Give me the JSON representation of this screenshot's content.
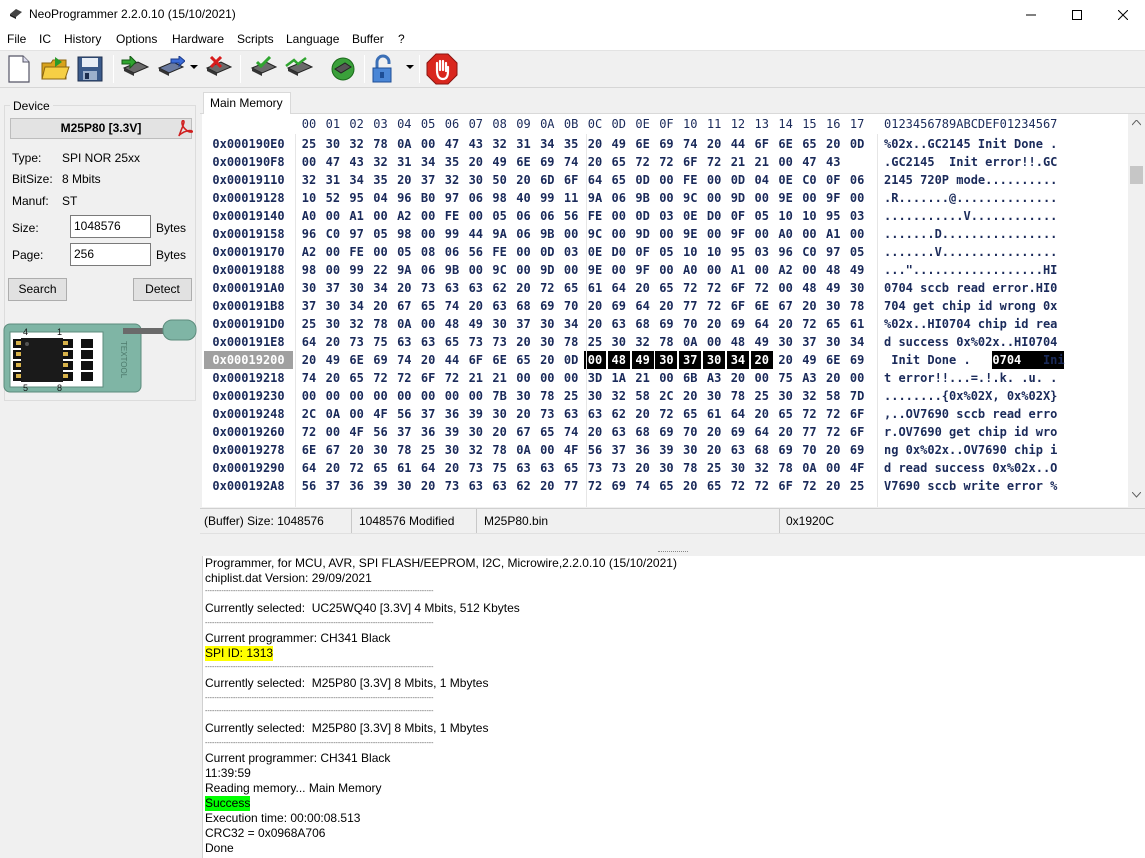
{
  "window": {
    "title": "NeoProgrammer 2.2.0.10 (15/10/2021)"
  },
  "menu": [
    "File",
    "IC",
    "History",
    "Options",
    "Hardware",
    "Scripts",
    "Language",
    "Buffer",
    "?"
  ],
  "toolbar": {
    "icons": [
      "new-file-icon",
      "open-folder-icon",
      "save-disk-icon",
      "read-chip-icon",
      "write-chip-icon",
      "erase-chip-icon",
      "verify-chip-icon",
      "blank-check-icon",
      "auto-program-icon",
      "protect-lock-icon",
      "stop-icon"
    ]
  },
  "device": {
    "group_label": "Device",
    "name": "M25P80 [3.3V]",
    "type_label": "Type:",
    "type_value": "SPI NOR 25xx",
    "bitsize_label": "BitSize:",
    "bitsize_value": "8 Mbits",
    "manuf_label": "Manuf:",
    "manuf_value": "ST",
    "size_label": "Size:",
    "size_value": "1048576",
    "size_unit": "Bytes",
    "page_label": "Page:",
    "page_value": "256",
    "page_unit": "Bytes",
    "search_button": "Search",
    "detect_button": "Detect",
    "socket_pin_labels": [
      "4",
      "1",
      "5",
      "8"
    ],
    "socket_brand": "TEXTOOL"
  },
  "hex": {
    "tab_label": "Main Memory",
    "header_bytes": [
      "00",
      "01",
      "02",
      "03",
      "04",
      "05",
      "06",
      "07",
      "08",
      "09",
      "0A",
      "0B",
      "0C",
      "0D",
      "0E",
      "0F",
      "10",
      "11",
      "12",
      "13",
      "14",
      "15",
      "16",
      "17"
    ],
    "header_ascii": "0123456789ABCDEF01234567",
    "rows": [
      {
        "addr": "0x000190E0",
        "bytes": [
          "25",
          "30",
          "32",
          "78",
          "0A",
          "00",
          "47",
          "43",
          "32",
          "31",
          "34",
          "35",
          "20",
          "49",
          "6E",
          "69",
          "74",
          "20",
          "44",
          "6F",
          "6E",
          "65",
          "20",
          "0D"
        ],
        "ascii": "%02x..GC2145 Init Done ."
      },
      {
        "addr": "0x000190F8",
        "bytes": [
          "00",
          "47",
          "43",
          "32",
          "31",
          "34",
          "35",
          "20",
          "49",
          "6E",
          "69",
          "74",
          "20",
          "65",
          "72",
          "72",
          "6F",
          "72",
          "21",
          "21",
          "00",
          "47",
          "43"
        ],
        "ascii": ".GC2145  Init error!!.GC"
      },
      {
        "addr": "0x00019110",
        "bytes": [
          "32",
          "31",
          "34",
          "35",
          "20",
          "37",
          "32",
          "30",
          "50",
          "20",
          "6D",
          "6F",
          "64",
          "65",
          "0D",
          "00",
          "FE",
          "00",
          "0D",
          "04",
          "0E",
          "C0",
          "0F",
          "06"
        ],
        "ascii": "2145 720P mode.........."
      },
      {
        "addr": "0x00019128",
        "bytes": [
          "10",
          "52",
          "95",
          "04",
          "96",
          "B0",
          "97",
          "06",
          "98",
          "40",
          "99",
          "11",
          "9A",
          "06",
          "9B",
          "00",
          "9C",
          "00",
          "9D",
          "00",
          "9E",
          "00",
          "9F",
          "00"
        ],
        "ascii": ".R.......@.............."
      },
      {
        "addr": "0x00019140",
        "bytes": [
          "A0",
          "00",
          "A1",
          "00",
          "A2",
          "00",
          "FE",
          "00",
          "05",
          "06",
          "06",
          "56",
          "FE",
          "00",
          "0D",
          "03",
          "0E",
          "D0",
          "0F",
          "05",
          "10",
          "10",
          "95",
          "03"
        ],
        "ascii": "...........V............"
      },
      {
        "addr": "0x00019158",
        "bytes": [
          "96",
          "C0",
          "97",
          "05",
          "98",
          "00",
          "99",
          "44",
          "9A",
          "06",
          "9B",
          "00",
          "9C",
          "00",
          "9D",
          "00",
          "9E",
          "00",
          "9F",
          "00",
          "A0",
          "00",
          "A1",
          "00"
        ],
        "ascii": ".......D................"
      },
      {
        "addr": "0x00019170",
        "bytes": [
          "A2",
          "00",
          "FE",
          "00",
          "05",
          "08",
          "06",
          "56",
          "FE",
          "00",
          "0D",
          "03",
          "0E",
          "D0",
          "0F",
          "05",
          "10",
          "10",
          "95",
          "03",
          "96",
          "C0",
          "97",
          "05"
        ],
        "ascii": ".......V................"
      },
      {
        "addr": "0x00019188",
        "bytes": [
          "98",
          "00",
          "99",
          "22",
          "9A",
          "06",
          "9B",
          "00",
          "9C",
          "00",
          "9D",
          "00",
          "9E",
          "00",
          "9F",
          "00",
          "A0",
          "00",
          "A1",
          "00",
          "A2",
          "00",
          "48",
          "49"
        ],
        "ascii": "...\"..................HI"
      },
      {
        "addr": "0x000191A0",
        "bytes": [
          "30",
          "37",
          "30",
          "34",
          "20",
          "73",
          "63",
          "63",
          "62",
          "20",
          "72",
          "65",
          "61",
          "64",
          "20",
          "65",
          "72",
          "72",
          "6F",
          "72",
          "00",
          "48",
          "49",
          "30"
        ],
        "ascii": "0704 sccb read error.HI0"
      },
      {
        "addr": "0x000191B8",
        "bytes": [
          "37",
          "30",
          "34",
          "20",
          "67",
          "65",
          "74",
          "20",
          "63",
          "68",
          "69",
          "70",
          "20",
          "69",
          "64",
          "20",
          "77",
          "72",
          "6F",
          "6E",
          "67",
          "20",
          "30",
          "78"
        ],
        "ascii": "704 get chip id wrong 0x"
      },
      {
        "addr": "0x000191D0",
        "bytes": [
          "25",
          "30",
          "32",
          "78",
          "0A",
          "00",
          "48",
          "49",
          "30",
          "37",
          "30",
          "34",
          "20",
          "63",
          "68",
          "69",
          "70",
          "20",
          "69",
          "64",
          "20",
          "72",
          "65",
          "61"
        ],
        "ascii": "%02x..HI0704 chip id rea"
      },
      {
        "addr": "0x000191E8",
        "bytes": [
          "64",
          "20",
          "73",
          "75",
          "63",
          "63",
          "65",
          "73",
          "73",
          "20",
          "30",
          "78",
          "25",
          "30",
          "32",
          "78",
          "0A",
          "00",
          "48",
          "49",
          "30",
          "37",
          "30",
          "34"
        ],
        "ascii": "d success 0x%02x..HI0704"
      },
      {
        "addr": "0x00019200",
        "bytes": [
          "20",
          "49",
          "6E",
          "69",
          "74",
          "20",
          "44",
          "6F",
          "6E",
          "65",
          "20",
          "0D",
          "00",
          "48",
          "49",
          "30",
          "37",
          "30",
          "34",
          "20",
          "20",
          "49",
          "6E",
          "69"
        ],
        "ascii": " Init Done . HI0704   Ini"
      },
      {
        "addr": "0x00019218",
        "bytes": [
          "74",
          "20",
          "65",
          "72",
          "72",
          "6F",
          "72",
          "21",
          "21",
          "00",
          "00",
          "00",
          "3D",
          "1A",
          "21",
          "00",
          "6B",
          "A3",
          "20",
          "00",
          "75",
          "A3",
          "20",
          "00"
        ],
        "ascii": "t error!!...=.!.k. .u. ."
      },
      {
        "addr": "0x00019230",
        "bytes": [
          "00",
          "00",
          "00",
          "00",
          "00",
          "00",
          "00",
          "00",
          "7B",
          "30",
          "78",
          "25",
          "30",
          "32",
          "58",
          "2C",
          "20",
          "30",
          "78",
          "25",
          "30",
          "32",
          "58",
          "7D"
        ],
        "ascii": "........{0x%02X, 0x%02X}"
      },
      {
        "addr": "0x00019248",
        "bytes": [
          "2C",
          "0A",
          "00",
          "4F",
          "56",
          "37",
          "36",
          "39",
          "30",
          "20",
          "73",
          "63",
          "63",
          "62",
          "20",
          "72",
          "65",
          "61",
          "64",
          "20",
          "65",
          "72",
          "72",
          "6F"
        ],
        "ascii": ",..OV7690 sccb read erro"
      },
      {
        "addr": "0x00019260",
        "bytes": [
          "72",
          "00",
          "4F",
          "56",
          "37",
          "36",
          "39",
          "30",
          "20",
          "67",
          "65",
          "74",
          "20",
          "63",
          "68",
          "69",
          "70",
          "20",
          "69",
          "64",
          "20",
          "77",
          "72",
          "6F"
        ],
        "ascii": "r.OV7690 get chip id wro"
      },
      {
        "addr": "0x00019278",
        "bytes": [
          "6E",
          "67",
          "20",
          "30",
          "78",
          "25",
          "30",
          "32",
          "78",
          "0A",
          "00",
          "4F",
          "56",
          "37",
          "36",
          "39",
          "30",
          "20",
          "63",
          "68",
          "69",
          "70",
          "20",
          "69"
        ],
        "ascii": "ng 0x%02x..OV7690 chip i"
      },
      {
        "addr": "0x00019290",
        "bytes": [
          "64",
          "20",
          "72",
          "65",
          "61",
          "64",
          "20",
          "73",
          "75",
          "63",
          "63",
          "65",
          "73",
          "73",
          "20",
          "30",
          "78",
          "25",
          "30",
          "32",
          "78",
          "0A",
          "00",
          "4F"
        ],
        "ascii": "d read success 0x%02x..O"
      },
      {
        "addr": "0x000192A8",
        "bytes": [
          "56",
          "37",
          "36",
          "39",
          "30",
          "20",
          "73",
          "63",
          "63",
          "62",
          "20",
          "77",
          "72",
          "69",
          "74",
          "65",
          "20",
          "65",
          "72",
          "72",
          "6F",
          "72",
          "20",
          "25"
        ],
        "ascii": "V7690 sccb write error %"
      }
    ]
  },
  "status": {
    "buffer_size": "(Buffer) Size: 1048576",
    "modified": "1048576 Modified",
    "file": "M25P80.bin",
    "offset": "0x1920C"
  },
  "log": {
    "lines": [
      {
        "text": "Programmer, for MCU, AVR, SPI FLASH/EEPROM, I2C, Microwire,2.2.0.10 (15/10/2021)",
        "hl": ""
      },
      {
        "text": "chiplist.dat Version: 29/09/2021",
        "hl": ""
      },
      {
        "text": "--------------------------------------------------------------------------------------------------",
        "hl": ""
      },
      {
        "text": "Currently selected:  UC25WQ40 [3.3V] 4 Mbits, 512 Kbytes",
        "hl": ""
      },
      {
        "text": "--------------------------------------------------------------------------------------------------",
        "hl": ""
      },
      {
        "text": "Current programmer: CH341 Black",
        "hl": ""
      },
      {
        "text": "SPI ID: 1313",
        "hl": "y"
      },
      {
        "text": "--------------------------------------------------------------------------------------------------",
        "hl": ""
      },
      {
        "text": "Currently selected:  M25P80 [3.3V] 8 Mbits, 1 Mbytes",
        "hl": ""
      },
      {
        "text": "--------------------------------------------------------------------------------------------------",
        "hl": ""
      },
      {
        "text": "--------------------------------------------------------------------------------------------------",
        "hl": ""
      },
      {
        "text": "Currently selected:  M25P80 [3.3V] 8 Mbits, 1 Mbytes",
        "hl": ""
      },
      {
        "text": "--------------------------------------------------------------------------------------------------",
        "hl": ""
      },
      {
        "text": "Current programmer: CH341 Black",
        "hl": ""
      },
      {
        "text": "11:39:59",
        "hl": ""
      },
      {
        "text": "Reading memory... Main Memory",
        "hl": ""
      },
      {
        "text": "Success",
        "hl": "g"
      },
      {
        "text": "Execution time: 00:00:08.513",
        "hl": ""
      },
      {
        "text": "CRC32 = 0x0968A706",
        "hl": ""
      },
      {
        "text": "Done",
        "hl": ""
      }
    ]
  }
}
